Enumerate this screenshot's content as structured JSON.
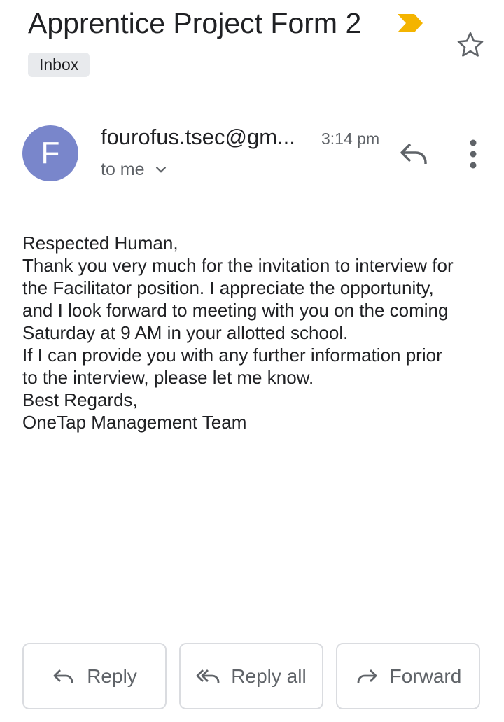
{
  "email": {
    "subject": "Apprentice Project Form 2",
    "label": "Inbox",
    "sender_initial": "F",
    "sender": "fourofus.tsec@gm...",
    "time": "3:14 pm",
    "recipient": "to me",
    "body_lines": [
      "Respected Human,",
      "Thank you very much for the invitation to interview for",
      "the Facilitator position. I appreciate the opportunity,",
      "and I look forward to meeting with you on the coming",
      "Saturday at 9 AM in your allotted school.",
      "If I can provide you with any further information prior",
      "to the interview, please let me know.",
      "Best Regards,",
      "OneTap Management Team"
    ]
  },
  "actions": {
    "reply": "Reply",
    "reply_all": "Reply all",
    "forward": "Forward"
  },
  "icons": {
    "importance": "importance-marker-icon",
    "star": "star-outline-icon",
    "reply": "reply-icon",
    "more": "more-vert-icon",
    "expand": "chevron-down-icon",
    "reply_all": "reply-all-icon",
    "forward": "forward-icon"
  },
  "colors": {
    "importance": "#f4b400",
    "avatar": "#7986cb",
    "chip_bg": "#e8eaed",
    "secondary_text": "#5f6368",
    "button_border": "#dadce0"
  }
}
